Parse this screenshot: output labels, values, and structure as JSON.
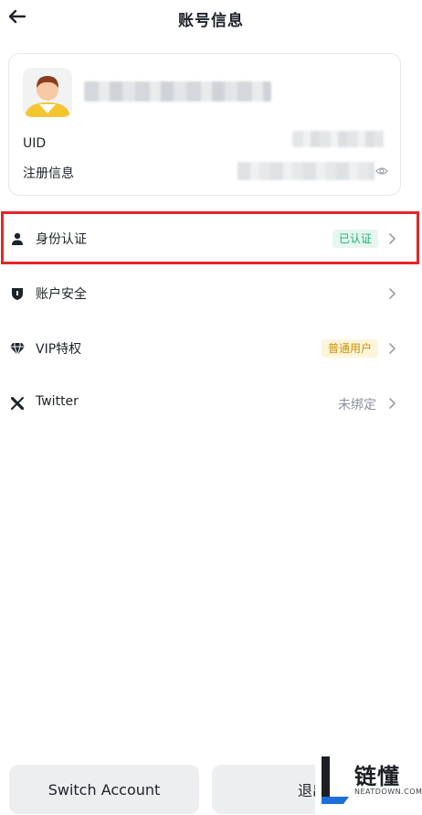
{
  "header": {
    "title": "账号信息"
  },
  "profile": {
    "uid_label": "UID",
    "register_label": "注册信息"
  },
  "menu": [
    {
      "label": "身份认证",
      "badge": "已认证",
      "icon": "person-icon"
    },
    {
      "label": "账户安全",
      "icon": "shield-icon"
    },
    {
      "label": "VIP特权",
      "badge": "普通用户",
      "icon": "diamond-icon"
    },
    {
      "label": "Twitter",
      "value": "未绑定",
      "icon": "x-logo-icon"
    }
  ],
  "buttons": {
    "switch_account": "Switch Account",
    "logout": "退出"
  },
  "watermark": {
    "text": "链懂",
    "sub": "NEATDOWN.COM"
  },
  "colors": {
    "highlight": "#e3262b",
    "badge_green": "#1fae6c",
    "badge_yellow": "#c99400",
    "avatar_shirt": "#f3c52f"
  }
}
